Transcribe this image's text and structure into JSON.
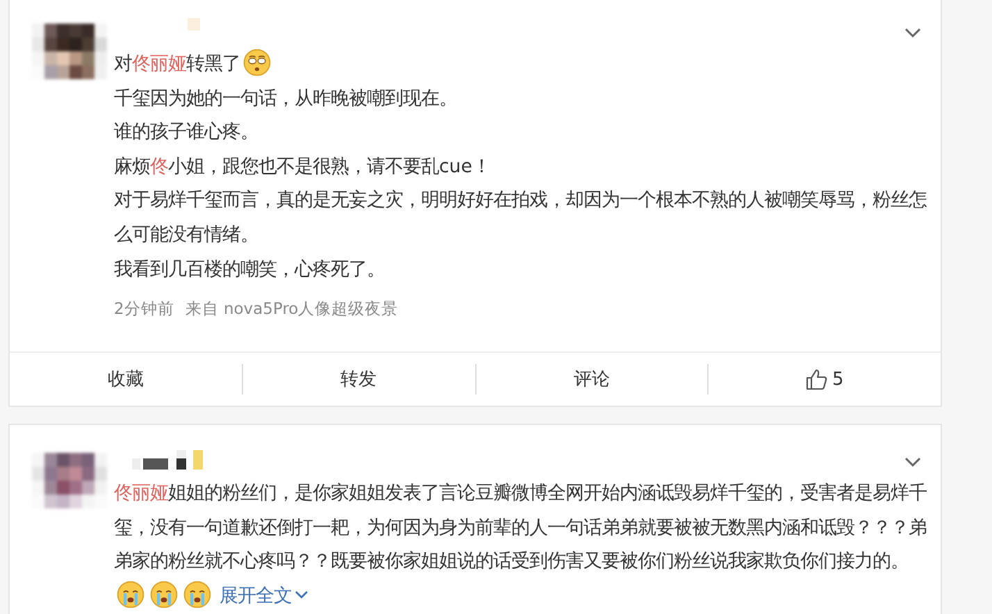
{
  "posts": [
    {
      "paragraphs": [
        [
          {
            "kind": "text",
            "text": "对"
          },
          {
            "kind": "mention",
            "text": "佟丽娅"
          },
          {
            "kind": "text",
            "text": "转黑了"
          },
          {
            "kind": "dazed"
          }
        ],
        [
          {
            "kind": "text",
            "text": "千玺因为她的一句话，从昨晚被嘲到现在。"
          }
        ],
        [
          {
            "kind": "text",
            "text": "谁的孩子谁心疼。"
          }
        ],
        [
          {
            "kind": "text",
            "text": "麻烦"
          },
          {
            "kind": "mention",
            "text": "佟"
          },
          {
            "kind": "text",
            "text": "小姐，跟您也不是很熟，请不要乱cue！"
          }
        ],
        [
          {
            "kind": "text",
            "text": "对于易烊千玺而言，真的是无妄之灾，明明好好在拍戏，却因为一个根本不熟的人被嘲笑辱骂，粉丝怎么可能没有情绪。"
          }
        ],
        [
          {
            "kind": "text",
            "text": "我看到几百楼的嘲笑，心疼死了。"
          }
        ]
      ],
      "meta": {
        "time": "2分钟前",
        "source": "来自 nova5Pro人像超级夜景"
      },
      "actions": [
        {
          "kind": "text",
          "label": "收藏"
        },
        {
          "kind": "text",
          "label": "转发"
        },
        {
          "kind": "text",
          "label": "评论"
        },
        {
          "kind": "like",
          "label": "5"
        }
      ]
    },
    {
      "paragraphs": [
        [
          {
            "kind": "mention",
            "text": "佟丽娅"
          },
          {
            "kind": "text",
            "text": "姐姐的粉丝们，是你家姐姐发表了言论豆瓣微博全网开始内涵诋毁易烊千玺的，受害者是易烊千玺，没有一句道歉还倒打一耙，为何因为身为前辈的人一句话弟弟就要被被无数黑内涵和诋毁？？？弟弟家的粉丝就不心疼吗？？既要被你家姐姐说的话受到伤害又要被你们粉丝说我家欺负你们接力的。"
          },
          {
            "kind": "crying"
          },
          {
            "kind": "crying"
          },
          {
            "kind": "crying"
          },
          {
            "kind": "expand",
            "text": "展开全文"
          }
        ]
      ]
    }
  ]
}
